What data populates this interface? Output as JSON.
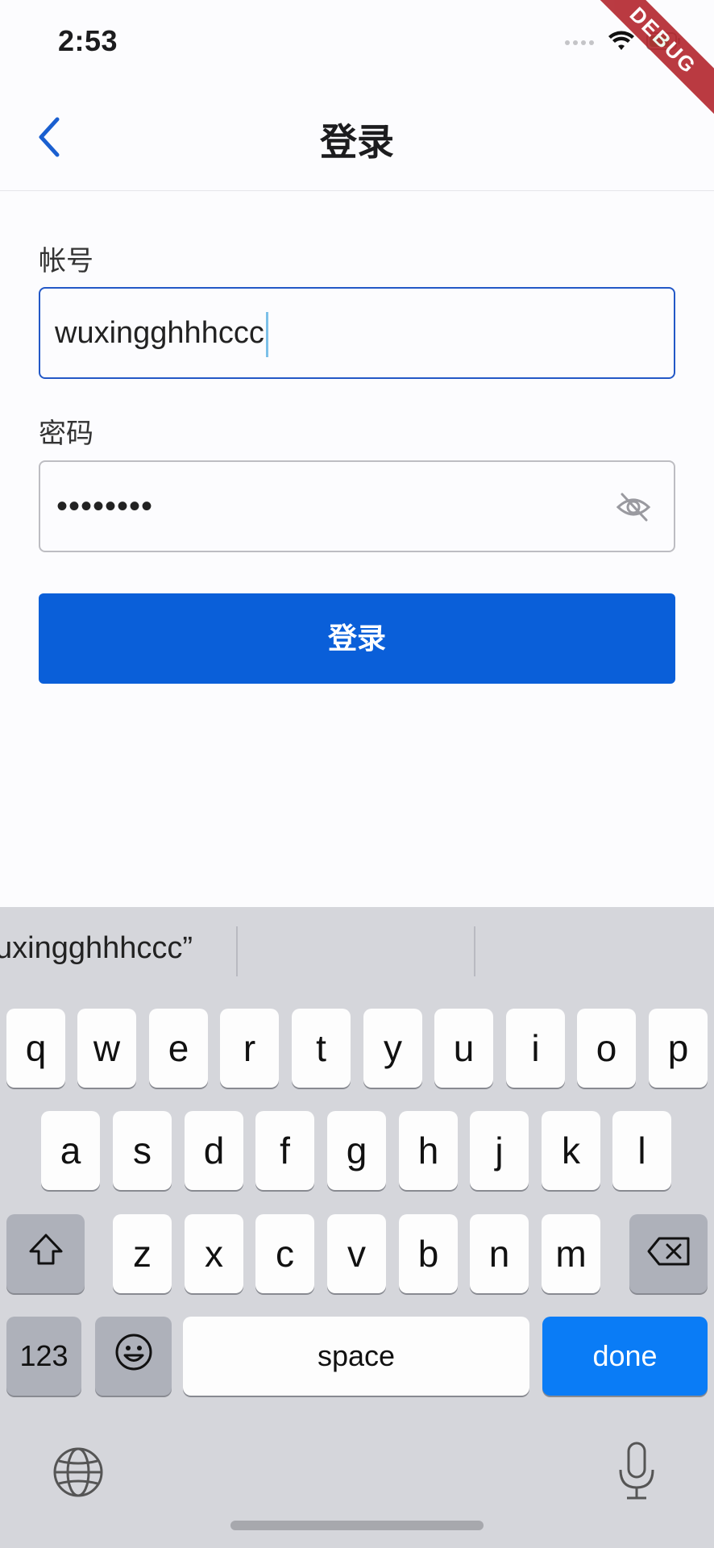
{
  "status_bar": {
    "time": "2:53",
    "debug_label": "DEBUG"
  },
  "nav": {
    "title": "登录"
  },
  "form": {
    "account_label": "帐号",
    "account_value": "wuxingghhhccc",
    "password_label": "密码",
    "password_masked": "••••••••",
    "submit_label": "登录"
  },
  "keyboard": {
    "suggestion": "uxingghhhccc”",
    "row1": [
      "q",
      "w",
      "e",
      "r",
      "t",
      "y",
      "u",
      "i",
      "o",
      "p"
    ],
    "row2": [
      "a",
      "s",
      "d",
      "f",
      "g",
      "h",
      "j",
      "k",
      "l"
    ],
    "row3": [
      "z",
      "x",
      "c",
      "v",
      "b",
      "n",
      "m"
    ],
    "numbers_key": "123",
    "space_key": "space",
    "done_key": "done"
  },
  "colors": {
    "accent": "#0a5fd9",
    "done_key": "#0a7cf6",
    "debug_ribbon": "#b3262d"
  }
}
